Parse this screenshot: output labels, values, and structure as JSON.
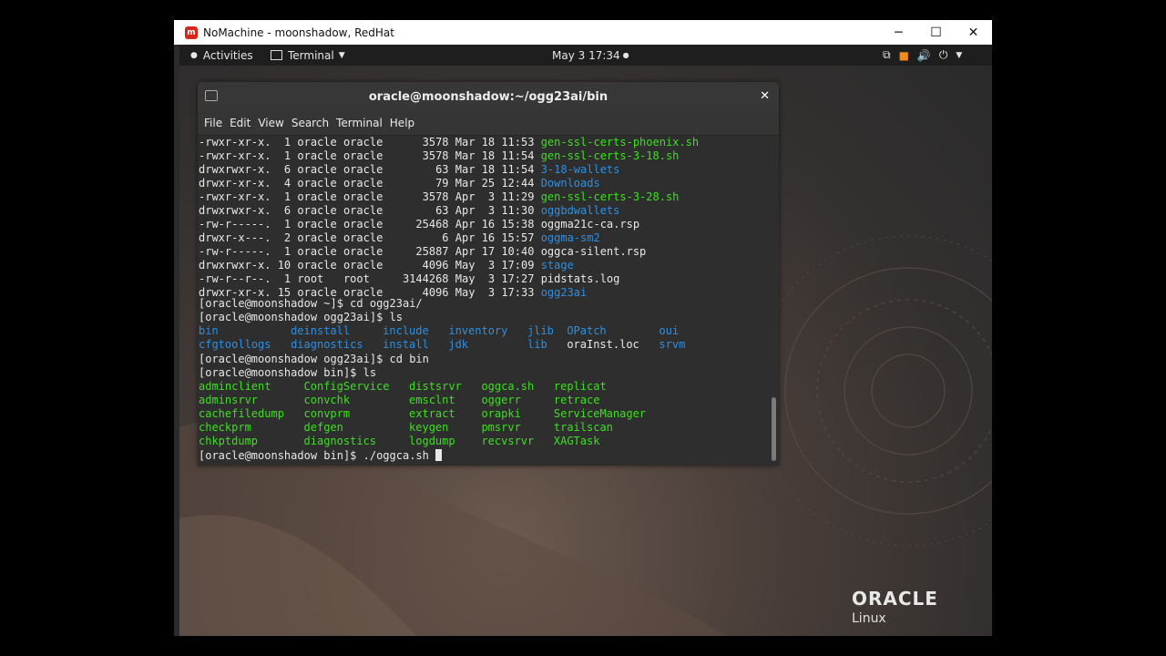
{
  "window": {
    "title": "NoMachine - moonshadow, RedHat",
    "logo_text": "m",
    "controls": {
      "minimize": "─",
      "maximize": "☐",
      "close": "✕"
    }
  },
  "topbar": {
    "activities": "Activities",
    "terminal_menu": "Terminal",
    "datetime": "May 3  17:34",
    "icons": [
      "network-icon",
      "notification-icon",
      "volume-icon",
      "power-icon",
      "chevron-down-icon"
    ]
  },
  "terminal": {
    "title": "oracle@moonshadow:~/ogg23ai/bin",
    "close": "✕",
    "menu": [
      "File",
      "Edit",
      "View",
      "Search",
      "Terminal",
      "Help"
    ],
    "listing": [
      {
        "meta": "-rwxr-xr-x.  1 oracle oracle      3578 Mar 18 11:53 ",
        "name": "gen-ssl-certs-phoenix.sh",
        "color": "g"
      },
      {
        "meta": "-rwxr-xr-x.  1 oracle oracle      3578 Mar 18 11:54 ",
        "name": "gen-ssl-certs-3-18.sh",
        "color": "g"
      },
      {
        "meta": "drwxrwxr-x.  6 oracle oracle        63 Mar 18 11:54 ",
        "name": "3-18-wallets",
        "color": "b"
      },
      {
        "meta": "drwxr-xr-x.  4 oracle oracle        79 Mar 25 12:44 ",
        "name": "Downloads",
        "color": "b"
      },
      {
        "meta": "-rwxr-xr-x.  1 oracle oracle      3578 Apr  3 11:29 ",
        "name": "gen-ssl-certs-3-28.sh",
        "color": "g"
      },
      {
        "meta": "drwxrwxr-x.  6 oracle oracle        63 Apr  3 11:30 ",
        "name": "oggbdwallets",
        "color": "b"
      },
      {
        "meta": "-rw-r-----.  1 oracle oracle     25468 Apr 16 15:38 ",
        "name": "oggma21c-ca.rsp",
        "color": "w"
      },
      {
        "meta": "drwxr-x---.  2 oracle oracle         6 Apr 16 15:57 ",
        "name": "oggma-sm2",
        "color": "b"
      },
      {
        "meta": "-rw-r-----.  1 oracle oracle     25887 Apr 17 10:40 ",
        "name": "oggca-silent.rsp",
        "color": "w"
      },
      {
        "meta": "drwxrwxr-x. 10 oracle oracle      4096 May  3 17:09 ",
        "name": "stage",
        "color": "b"
      },
      {
        "meta": "-rw-r--r--.  1 root   root     3144268 May  3 17:27 ",
        "name": "pidstats.log",
        "color": "w"
      },
      {
        "meta": "drwxr-xr-x. 15 oracle oracle      4096 May  3 17:33 ",
        "name": "ogg23ai",
        "color": "b"
      }
    ],
    "cmd1": "[oracle@moonshadow ~]$ cd ogg23ai/",
    "cmd2": "[oracle@moonshadow ogg23ai]$ ls",
    "ls1_row1": [
      {
        "t": "bin",
        "c": "b"
      },
      {
        "t": "deinstall",
        "c": "b"
      },
      {
        "t": "include",
        "c": "b"
      },
      {
        "t": "inventory",
        "c": "b"
      },
      {
        "t": "jlib",
        "c": "b"
      },
      {
        "t": "OPatch",
        "c": "b"
      },
      {
        "t": "oui",
        "c": "b"
      }
    ],
    "ls1_row2": [
      {
        "t": "cfgtoollogs",
        "c": "b"
      },
      {
        "t": "diagnostics",
        "c": "b"
      },
      {
        "t": "install",
        "c": "b"
      },
      {
        "t": "jdk",
        "c": "b"
      },
      {
        "t": "lib",
        "c": "b"
      },
      {
        "t": "oraInst.loc",
        "c": "w"
      },
      {
        "t": "srvm",
        "c": "b"
      }
    ],
    "cmd3": "[oracle@moonshadow ogg23ai]$ cd bin",
    "cmd4": "[oracle@moonshadow bin]$ ls",
    "ls2": [
      [
        "adminclient",
        "ConfigService",
        "distsrvr",
        "oggca.sh",
        "replicat"
      ],
      [
        "adminsrvr",
        "convchk",
        "emsclnt",
        "oggerr",
        "retrace"
      ],
      [
        "cachefiledump",
        "convprm",
        "extract",
        "orapki",
        "ServiceManager"
      ],
      [
        "checkprm",
        "defgen",
        "keygen",
        "pmsrvr",
        "trailscan"
      ],
      [
        "chkptdump",
        "diagnostics",
        "logdump",
        "recvsrvr",
        "XAGTask"
      ]
    ],
    "prompt_final": "[oracle@moonshadow bin]$ ./oggca.sh "
  },
  "brand": {
    "oracle": "ORACLE",
    "linux": "Linux"
  }
}
